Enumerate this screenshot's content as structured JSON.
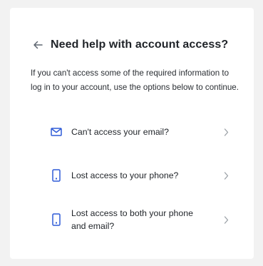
{
  "header": {
    "back_icon": "arrow-left-icon",
    "title": "Need help with account access?"
  },
  "description": "If you can't access some of the required information to log in to your account, use the options below to continue.",
  "options": [
    {
      "label": "Can't access your email?",
      "icon": "envelope-icon"
    },
    {
      "label": "Lost access to your phone?",
      "icon": "phone-icon"
    },
    {
      "label": "Lost access to both your phone and email?",
      "icon": "phone-icon"
    }
  ],
  "colors": {
    "accent": "#2f5bd7",
    "chevron": "#9aa0a6",
    "back_arrow": "#5f6670",
    "card_background": "#ffffff",
    "page_background": "#f2f2f2"
  }
}
